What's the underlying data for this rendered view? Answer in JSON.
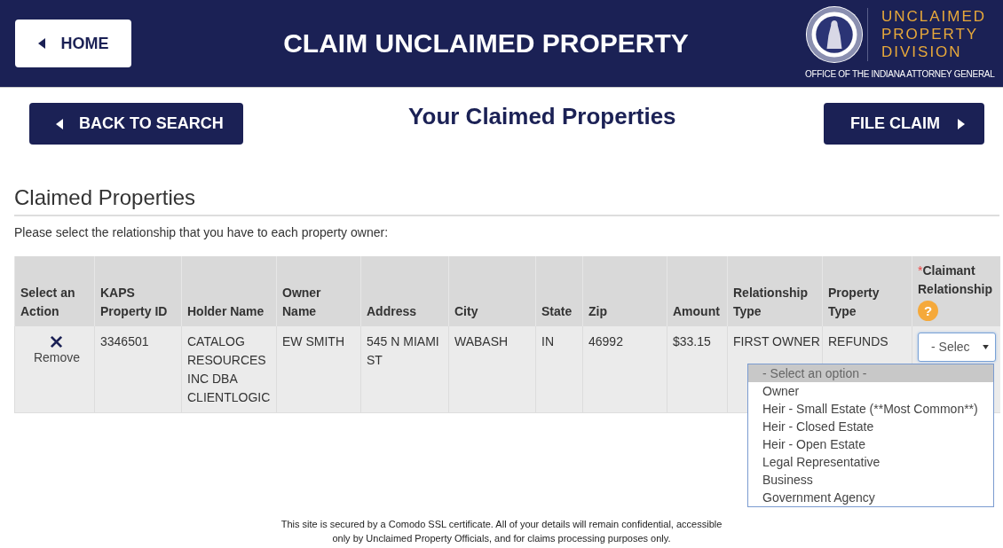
{
  "header": {
    "home_button": "HOME",
    "title": "CLAIM UNCLAIMED PROPERTY",
    "logo": {
      "lines": [
        "UNCLAIMED",
        "PROPERTY",
        "DIVISION"
      ],
      "caption": "OFFICE OF THE INDIANA ATTORNEY GENERAL"
    }
  },
  "toolbar": {
    "back_button": "BACK TO SEARCH",
    "title": "Your Claimed Properties",
    "file_button": "FILE CLAIM"
  },
  "section": {
    "heading": "Claimed Properties",
    "instruction": "Please select the relationship that you have to each property owner:"
  },
  "table": {
    "columns": [
      {
        "label": "Select an Action"
      },
      {
        "label": "KAPS Property ID"
      },
      {
        "label": "Holder Name"
      },
      {
        "label": "Owner Name"
      },
      {
        "label": "Address"
      },
      {
        "label": "City"
      },
      {
        "label": "State"
      },
      {
        "label": "Zip"
      },
      {
        "label": "Amount"
      },
      {
        "label": "Relationship Type"
      },
      {
        "label": "Property Type"
      },
      {
        "label": "Claimant Relationship",
        "required_mark": "*",
        "help": "?"
      }
    ],
    "rows": [
      {
        "cells": [
          "Remove",
          "3346501",
          "CATALOG RESOURCES INC DBA CLIENTLOGIC",
          "EW SMITH",
          "545 N MIAMI ST",
          "WABASH",
          "IN",
          "46992",
          "$33.15",
          "FIRST OWNER",
          "REFUNDS"
        ],
        "relationship": {
          "value": "- Selec",
          "expanded": true
        }
      }
    ]
  },
  "dropdown": {
    "options": [
      {
        "label": "- Select an option -",
        "selected": true
      },
      {
        "label": "Owner",
        "selected": false
      },
      {
        "label": "Heir - Small Estate (**Most Common**)",
        "selected": false
      },
      {
        "label": "Heir - Closed Estate",
        "selected": false
      },
      {
        "label": "Heir - Open Estate",
        "selected": false
      },
      {
        "label": "Legal Representative",
        "selected": false
      },
      {
        "label": "Business",
        "selected": false
      },
      {
        "label": "Government Agency",
        "selected": false
      }
    ]
  },
  "footer": "This site is secured by a Comodo SSL certificate. All of your details will remain confidential, accessible only by Unclaimed Property Officials, and for claims processing purposes only."
}
